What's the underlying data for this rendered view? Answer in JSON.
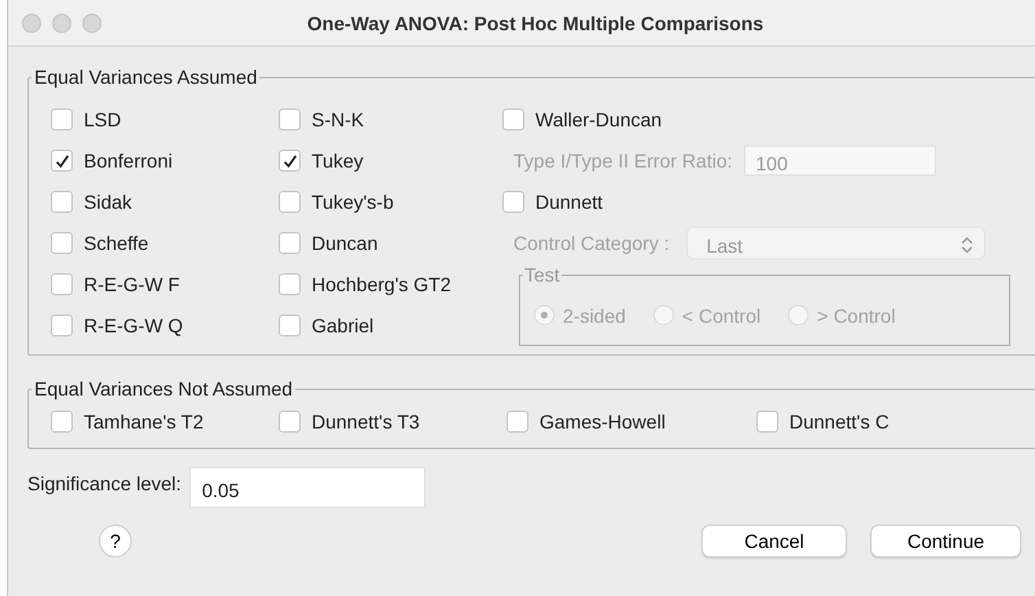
{
  "window": {
    "title": "One-Way ANOVA: Post Hoc Multiple Comparisons"
  },
  "equal_variances_assumed": {
    "title": "Equal Variances Assumed",
    "column_1": [
      {
        "label": "LSD",
        "checked": false
      },
      {
        "label": "Bonferroni",
        "checked": true
      },
      {
        "label": "Sidak",
        "checked": false
      },
      {
        "label": "Scheffe",
        "checked": false
      },
      {
        "label": "R-E-G-W F",
        "checked": false
      },
      {
        "label": "R-E-G-W Q",
        "checked": false
      }
    ],
    "column_2": [
      {
        "label": "S-N-K",
        "checked": false
      },
      {
        "label": "Tukey",
        "checked": true
      },
      {
        "label": "Tukey's-b",
        "checked": false
      },
      {
        "label": "Duncan",
        "checked": false
      },
      {
        "label": "Hochberg's GT2",
        "checked": false
      },
      {
        "label": "Gabriel",
        "checked": false
      }
    ],
    "waller_duncan": {
      "label": "Waller-Duncan",
      "checked": false
    },
    "error_ratio": {
      "label": "Type I/Type II Error Ratio:",
      "value": "100",
      "disabled": true
    },
    "dunnett": {
      "label": "Dunnett",
      "checked": false
    },
    "control_category": {
      "label": "Control Category :",
      "value": "Last",
      "disabled": true
    },
    "test": {
      "title": "Test",
      "disabled": true,
      "options": [
        {
          "label": "2-sided",
          "selected": true
        },
        {
          "label": "< Control",
          "selected": false
        },
        {
          "label": "> Control",
          "selected": false
        }
      ]
    }
  },
  "equal_variances_not_assumed": {
    "title": "Equal Variances Not Assumed",
    "tests": [
      {
        "label": "Tamhane's T2",
        "checked": false
      },
      {
        "label": "Dunnett's T3",
        "checked": false
      },
      {
        "label": "Games-Howell",
        "checked": false
      },
      {
        "label": "Dunnett's C",
        "checked": false
      }
    ]
  },
  "significance_level": {
    "label": "Significance level:",
    "value": "0.05"
  },
  "buttons": [
    {
      "label": "?",
      "kind": "help"
    },
    {
      "label": "Cancel",
      "kind": "normal"
    },
    {
      "label": "Continue",
      "kind": "normal"
    }
  ]
}
